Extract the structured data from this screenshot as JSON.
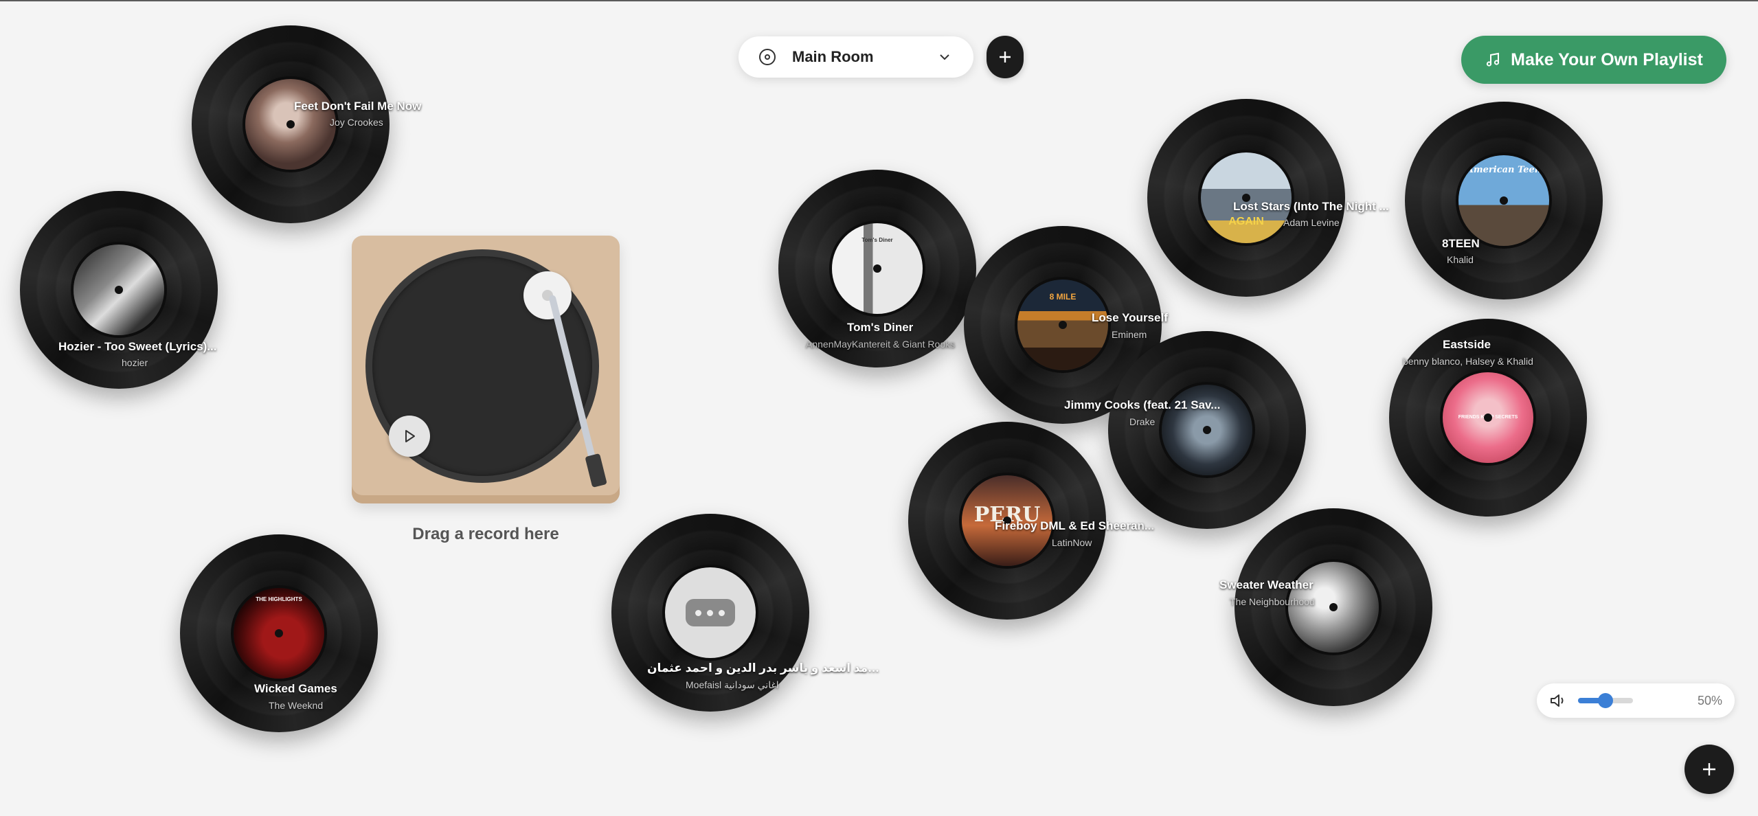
{
  "header": {
    "room_selector": {
      "icon": "disc-icon",
      "value": "Main Room"
    },
    "add_room_icon": "plus-icon",
    "playlist_button": {
      "label": "Make Your Own Playlist",
      "icon": "music-note-icon",
      "color": "#3a9a66"
    }
  },
  "turntable": {
    "play_icon": "play-icon",
    "hint": "Drag a record here",
    "base_color": "#d8bda0"
  },
  "records": [
    {
      "title": "Feet Don't Fail Me Now",
      "artist": "Joy Crookes"
    },
    {
      "title": "Hozier - Too Sweet (Lyrics)...",
      "artist": "hozier"
    },
    {
      "title": "Wicked Games",
      "artist": "The Weeknd",
      "art_text": "THE HIGHLIGHTS"
    },
    {
      "title": "…مد اسعد و ياسر بدر الدين و احمد عثمان",
      "artist": "Moefaisl اغاني سودانية"
    },
    {
      "title": "Tom's Diner",
      "artist": "AnnenMayKantereit & Giant Rooks",
      "art_text": "Tom's Diner"
    },
    {
      "title": "Lose Yourself",
      "artist": "Eminem",
      "art_text": "8 MILE"
    },
    {
      "title": "Fireboy DML & Ed Sheeran...",
      "artist": "LatinNow",
      "art_text": "PERU"
    },
    {
      "title": "Lost Stars (Into The Night ...",
      "artist": "Adam Levine",
      "art_text": "AGAIN"
    },
    {
      "title": "Jimmy Cooks (feat. 21 Sav...",
      "artist": "Drake"
    },
    {
      "title": "8TEEN",
      "artist": "Khalid",
      "art_text": "American Teen"
    },
    {
      "title": "Eastside",
      "artist": "benny blanco, Halsey & Khalid",
      "art_text": "FRIENDS KEEP SECRETS"
    },
    {
      "title": "Sweater Weather",
      "artist": "The Neighbourhood"
    }
  ],
  "volume": {
    "icon": "speaker-icon",
    "level": 0.5,
    "percent_label": "50%",
    "accent": "#3b7fd6"
  },
  "fab": {
    "icon": "plus-icon"
  }
}
